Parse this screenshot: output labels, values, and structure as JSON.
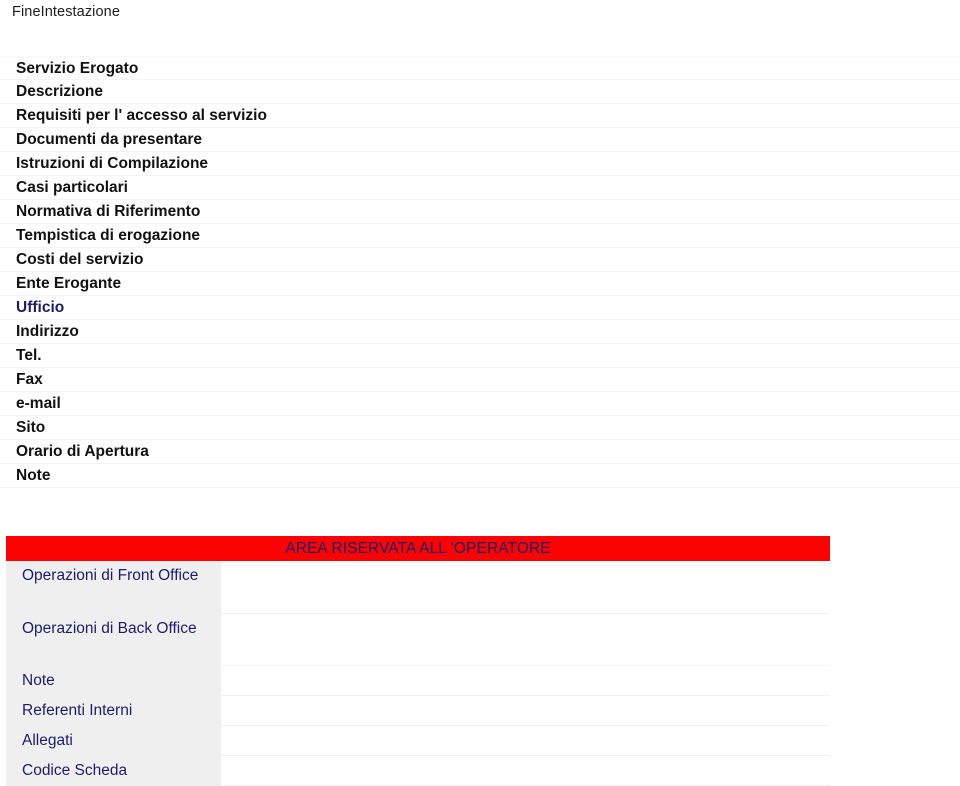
{
  "header": {
    "title": "FineIntestazione"
  },
  "service_fields": [
    {
      "label": "Servizio Erogato",
      "accent": false
    },
    {
      "label": "Descrizione",
      "accent": false
    },
    {
      "label": "Requisiti per l' accesso al servizio",
      "accent": false
    },
    {
      "label": "Documenti da presentare",
      "accent": false
    },
    {
      "label": "Istruzioni di Compilazione",
      "accent": false
    },
    {
      "label": "Casi particolari",
      "accent": false
    },
    {
      "label": "Normativa di Riferimento",
      "accent": false
    },
    {
      "label": "Tempistica di erogazione",
      "accent": false
    },
    {
      "label": "Costi del servizio",
      "accent": false
    },
    {
      "label": "Ente Erogante",
      "accent": false
    },
    {
      "label": "Ufficio",
      "accent": true
    },
    {
      "label": "Indirizzo",
      "accent": false
    },
    {
      "label": "Tel.",
      "accent": false
    },
    {
      "label": "Fax",
      "accent": false
    },
    {
      "label": "e-mail",
      "accent": false
    },
    {
      "label": "Sito",
      "accent": false
    },
    {
      "label": "Orario di Apertura",
      "accent": false
    },
    {
      "label": "Note",
      "accent": false
    }
  ],
  "reserved_area": {
    "banner_title": "AREA RISERVATA ALL 'OPERATORE",
    "banner_background": "#fc0303",
    "banner_text_color": "#1d1d66",
    "label_column_background": "#efefef",
    "rows": [
      {
        "label": "Operazioni di Front Office",
        "value": "",
        "size": "tall"
      },
      {
        "label": "Operazioni di Back Office",
        "value": "",
        "size": "tall"
      },
      {
        "label": "Note",
        "value": "",
        "size": "short"
      },
      {
        "label": "Referenti Interni",
        "value": "",
        "size": "short"
      },
      {
        "label": "Allegati",
        "value": "",
        "size": "short"
      },
      {
        "label": "Codice Scheda",
        "value": "",
        "size": "short"
      }
    ]
  }
}
